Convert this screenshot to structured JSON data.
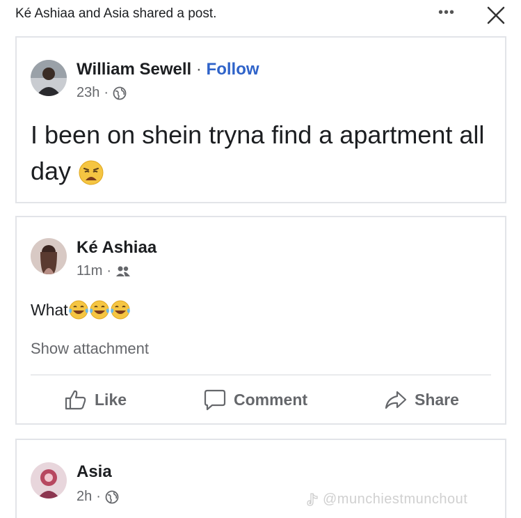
{
  "header": {
    "title": "Ké Ashiaa and Asia shared a post.",
    "more_label": "•••"
  },
  "original_post": {
    "author": "William Sewell",
    "separator": "·",
    "follow_label": "Follow",
    "time": "23h",
    "privacy_icon": "globe-icon",
    "text": "I been on shein tryna find a apartment all day",
    "emoji": "weary-face"
  },
  "share_one": {
    "author": "Ké Ashiaa",
    "time": "11m",
    "privacy_icon": "friends-icon",
    "text": "What",
    "emoji": [
      "tears-of-joy",
      "tears-of-joy",
      "tears-of-joy"
    ],
    "attachment_label": "Show attachment",
    "actions": {
      "like": "Like",
      "comment": "Comment",
      "share": "Share"
    }
  },
  "share_two": {
    "author": "Asia",
    "time": "2h",
    "privacy_icon": "globe-icon"
  },
  "watermark": {
    "text": "@munchiestmunchout",
    "icon": "tiktok-icon"
  },
  "colors": {
    "accent": "#2f63c9",
    "muted": "#65676b",
    "border": "#e2e4e8"
  }
}
